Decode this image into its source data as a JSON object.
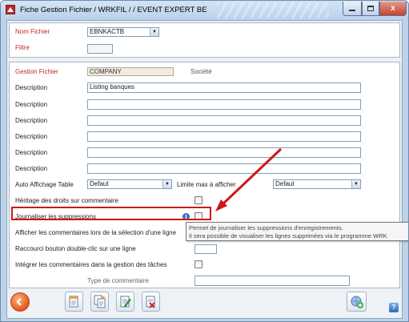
{
  "window": {
    "title": "Fiche Gestion Fichier / WRKFIL /  / EVENT EXPERT BE",
    "close_label": "x"
  },
  "top": {
    "nom_fichier_label": "Nom Fichier",
    "nom_fichier_value": "EBNKACTB",
    "filtre_label": "Filtre",
    "filtre_value": ""
  },
  "main": {
    "gestion_fichier_label": "Gestion Fichier",
    "gestion_fichier_value": "COMPANY",
    "societe_label": "Société",
    "descriptions": [
      {
        "label": "Description",
        "value": "Listing banques"
      },
      {
        "label": "Description",
        "value": ""
      },
      {
        "label": "Description",
        "value": ""
      },
      {
        "label": "Description",
        "value": ""
      },
      {
        "label": "Description",
        "value": ""
      },
      {
        "label": "Description",
        "value": ""
      }
    ],
    "auto_affichage_label": "Auto Affichage Table",
    "auto_affichage_value": "Defaut",
    "limite_max_label": "Limite max à afficher",
    "limite_max_value": "Defaut",
    "heritage_label": "Héritage des droits sur commentaire",
    "journaliser_label": "Journaliser les suppressions",
    "afficher_label": "Afficher les commentaires lors de la sélection d'une ligne",
    "raccourci_label": "Raccourci bouton double-clic sur une ligne",
    "integrer_label": "Intégrer les commentaires dans la gestion des tâches",
    "type_commentaire_label": "Type de commentaire",
    "type_commentaire_value": ""
  },
  "tooltip": {
    "line1": "Permet de journaliser les suppressions d'enregistrements.",
    "line2": "Il sera possible de visualiser les lignes supprimées via le programme WRK"
  },
  "colors": {
    "label_red": "#c0282b",
    "highlight_red": "#cc1818",
    "window_blue": "#bcd3ea"
  },
  "icons": {
    "back": "back-arrow-icon",
    "toolbar": [
      "copy-record-icon",
      "duplicate-record-icon",
      "edit-record-icon",
      "delete-record-icon"
    ],
    "add": "add-globe-icon",
    "help": "help-icon"
  }
}
